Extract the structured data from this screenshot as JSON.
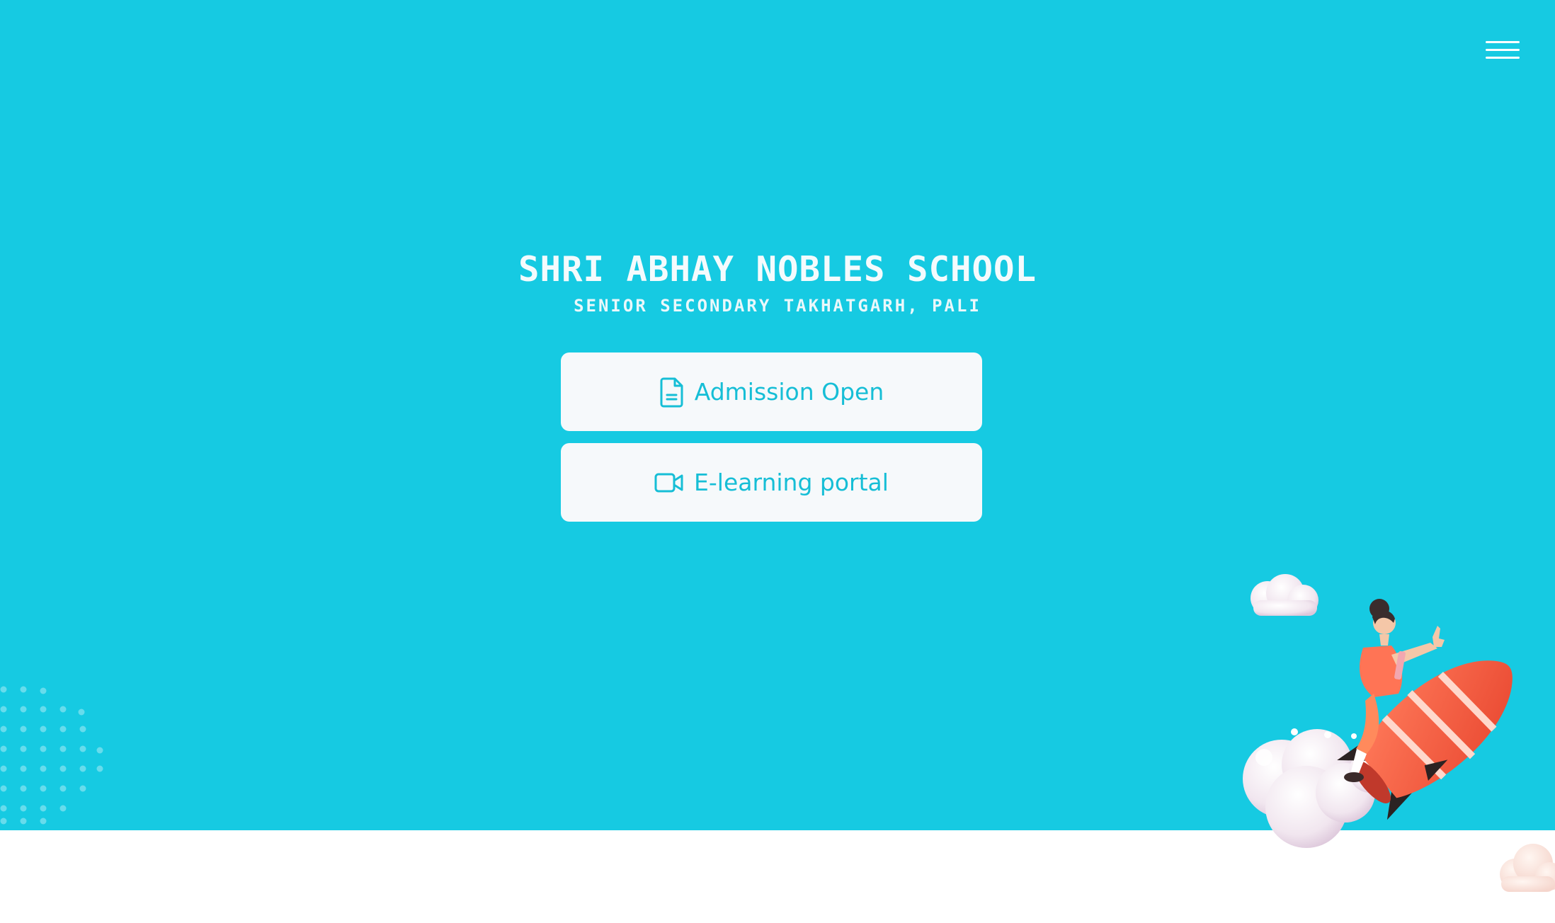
{
  "header": {
    "menu_icon": "hamburger-menu-icon"
  },
  "hero": {
    "title": "SHRI ABHAY NOBLES SCHOOL",
    "subtitle": "SENIOR SECONDARY TAKHATGARH, PALI",
    "background_color": "#16cae2",
    "buttons": [
      {
        "label": "Admission Open",
        "icon": "document-icon"
      },
      {
        "label": "E-learning portal",
        "icon": "video-camera-icon"
      }
    ]
  },
  "colors": {
    "accent": "#16bed6",
    "button_bg": "#f6f9fb",
    "text_light": "#f4fbfd"
  }
}
